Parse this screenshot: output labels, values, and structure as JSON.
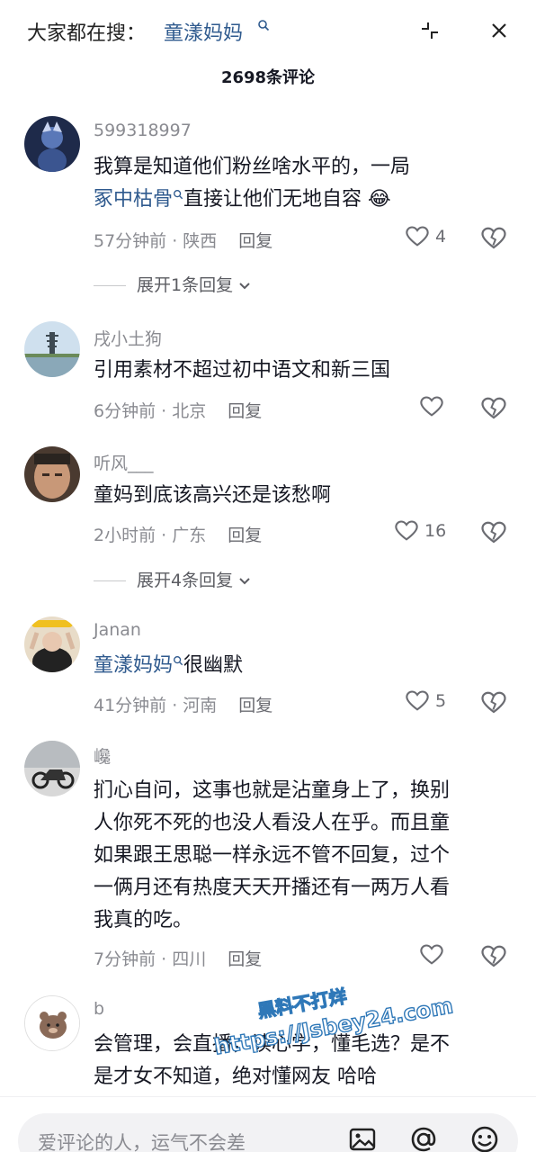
{
  "header": {
    "search_prefix": "大家都在搜：",
    "search_term": "童漾妈妈",
    "comment_count": "2698条评论"
  },
  "comments": [
    {
      "username": "599318997",
      "text_line1": "我算是知道他们粉丝啥水平的，一局",
      "link": "冢中枯骨",
      "text_after_link": "直接让他们无地自容",
      "emoji": "😂",
      "meta": "57分钟前 · 陕西",
      "reply": "回复",
      "likes": "4",
      "expand": "展开1条回复"
    },
    {
      "username": "戌小土狗",
      "text": "引用素材不超过初中语文和新三国",
      "meta": "6分钟前 · 北京",
      "reply": "回复"
    },
    {
      "username": "听风___",
      "text": "童妈到底该高兴还是该愁啊",
      "meta": "2小时前 · 广东",
      "reply": "回复",
      "likes": "16",
      "expand": "展开4条回复"
    },
    {
      "username": "Janan",
      "link": "童漾妈妈",
      "text_after_link": "很幽默",
      "meta": "41分钟前 · 河南",
      "reply": "回复",
      "likes": "5"
    },
    {
      "username": "巉",
      "lines": [
        "扪心自问，这事也就是沾童身上了，换别",
        "人你死不死的也没人看没人在乎。而且童",
        "如果跟王思聪一样永远不管不回复，过个",
        "一俩月还有热度天天开播还有一两万人看",
        "我真的吃。"
      ],
      "meta": "7分钟前 · 四川",
      "reply": "回复"
    },
    {
      "username": "b",
      "lines": [
        "会管理，会直播，读心学，懂毛选？是不",
        "是才女不知道，绝对懂网友 哈哈"
      ]
    }
  ],
  "watermark": {
    "line1": "黑料不打烊",
    "line2": "https://Jsbey24.com"
  },
  "bottom_bar": {
    "placeholder": "爱评论的人，运气不会差"
  },
  "icons": {
    "search": "search-icon",
    "collapse": "collapse-icon",
    "close": "close-icon",
    "like": "heart-icon",
    "dislike": "broken-heart-icon",
    "image": "image-icon",
    "mention": "at-icon",
    "emoji": "emoji-icon"
  }
}
